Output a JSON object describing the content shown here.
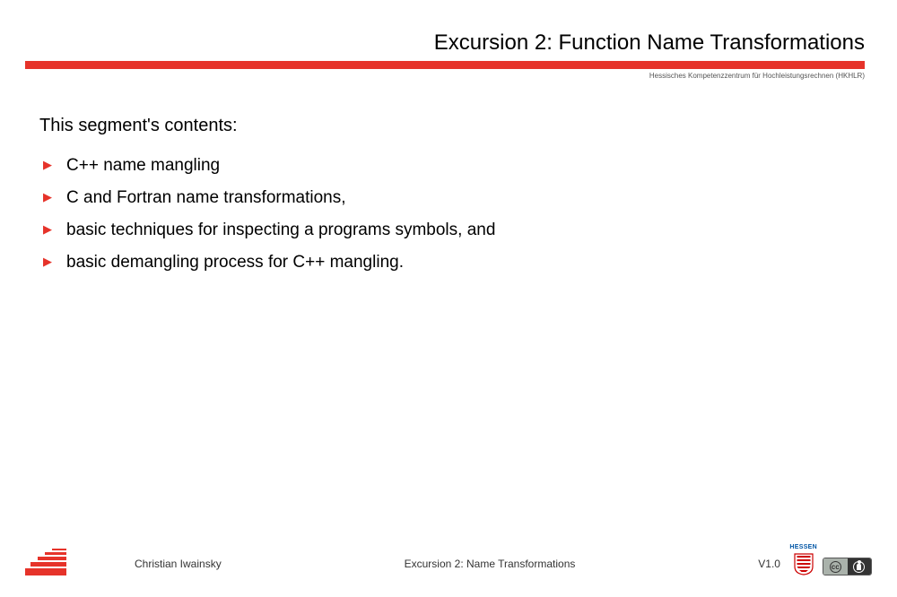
{
  "header": {
    "title": "Excursion 2: Function Name Transformations",
    "subtitle": "Hessisches Kompetenzzentrum für Hochleistungsrechnen (HKHLR)"
  },
  "content": {
    "intro": "This segment's contents:",
    "bullets": [
      "C++ name mangling",
      "C and Fortran name transformations,",
      "basic techniques for inspecting a programs symbols, and",
      "basic demangling process for C++ mangling."
    ]
  },
  "footer": {
    "author": "Christian Iwainsky",
    "center": "Excursion 2: Name Transformations",
    "version": "V1.0",
    "hessen_label": "HESSEN"
  }
}
